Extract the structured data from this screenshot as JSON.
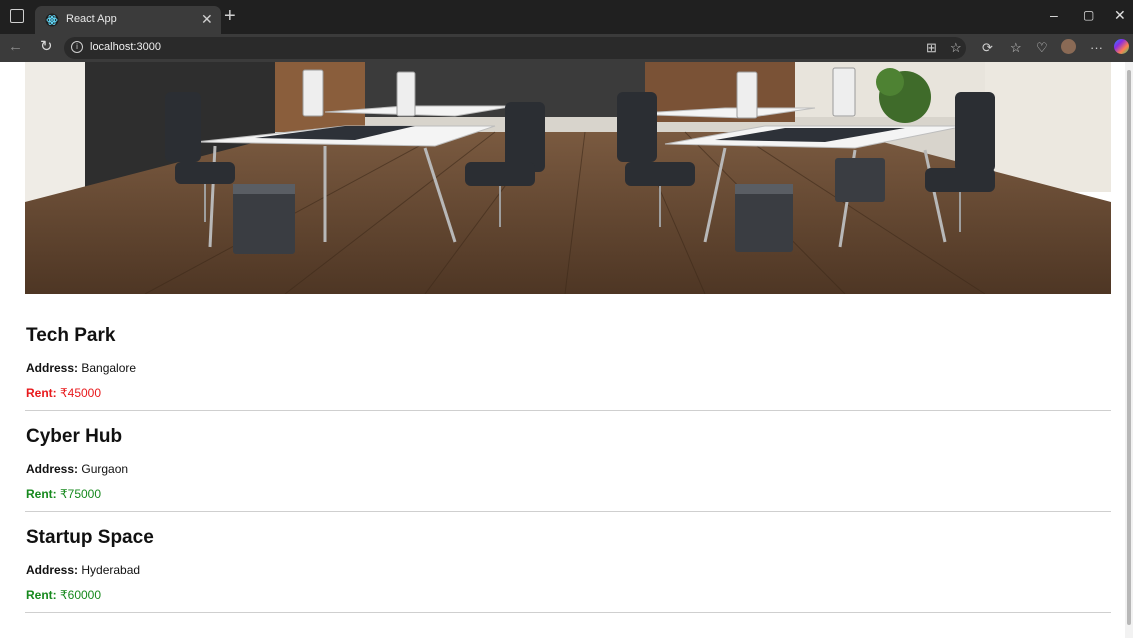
{
  "browser": {
    "tab_title": "React App",
    "url": "localhost:3000"
  },
  "listings": [
    {
      "name": "Tech Park",
      "address_label": "Address:",
      "address": "Bangalore",
      "rent_label": "Rent:",
      "rent": "₹45000",
      "rent_color": "#e8191c"
    },
    {
      "name": "Cyber Hub",
      "address_label": "Address:",
      "address": "Gurgaon",
      "rent_label": "Rent:",
      "rent": "₹75000",
      "rent_color": "#16891d"
    },
    {
      "name": "Startup Space",
      "address_label": "Address:",
      "address": "Hyderabad",
      "rent_label": "Rent:",
      "rent": "₹60000",
      "rent_color": "#16891d"
    }
  ]
}
